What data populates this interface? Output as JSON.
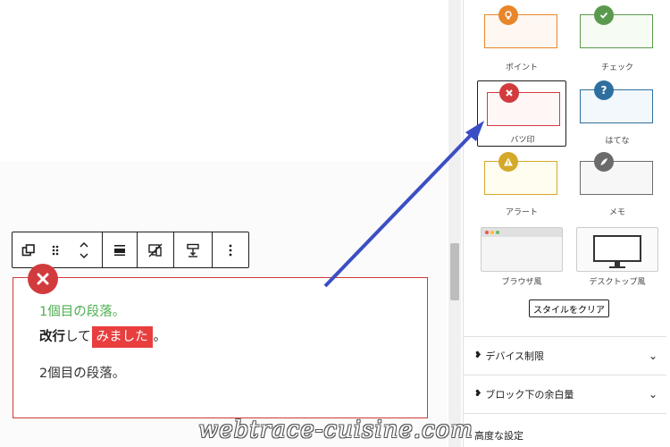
{
  "editor": {
    "paragraph_1": "1個目の段落。",
    "paragraph_2": {
      "bold": "改行",
      "normal": "して",
      "highlight": "みました",
      "end": "。"
    },
    "paragraph_3": "2個目の段落。"
  },
  "sidebar": {
    "styles": [
      {
        "label": "ポイント",
        "color": "#e8862a",
        "icon": "lightbulb-icon"
      },
      {
        "label": "チェック",
        "color": "#5b9a4e",
        "icon": "check-icon"
      },
      {
        "label": "バツ印",
        "color": "#d23b3e",
        "icon": "cross-icon",
        "selected": true
      },
      {
        "label": "はてな",
        "color": "#2f6f9f",
        "icon": "question-icon"
      },
      {
        "label": "アラート",
        "color": "#d4a92a",
        "icon": "alert-icon"
      },
      {
        "label": "メモ",
        "color": "#6b6b6b",
        "icon": "pen-icon"
      },
      {
        "label": "ブラウザ風",
        "icon": "browser-icon"
      },
      {
        "label": "デスクトップ風",
        "icon": "desktop-icon"
      }
    ],
    "clear_button": "スタイルをクリア",
    "panels": [
      {
        "title": "デバイス制限"
      },
      {
        "title": "ブロック下の余白量"
      },
      {
        "title": "高度な設定"
      }
    ]
  },
  "watermark": "webtrace-cuisine.com"
}
